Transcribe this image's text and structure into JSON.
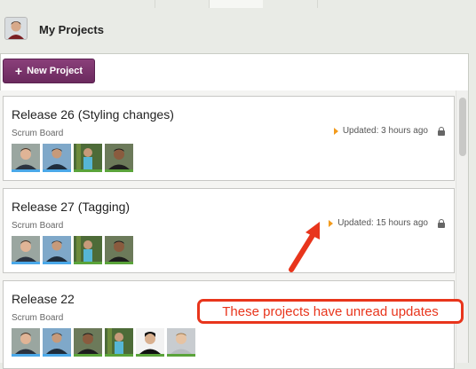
{
  "header": {
    "title": "My Projects",
    "avatar_icon": "user-avatar"
  },
  "toolbar": {
    "new_project_label": "New Project",
    "new_project_icon": "plus-icon"
  },
  "projects": [
    {
      "title": "Release 26 (Styling changes)",
      "board": "Scrum Board",
      "updated": "Updated: 3 hours ago",
      "unread": true,
      "private": true,
      "members": [
        {
          "underline": "#4aa8e8"
        },
        {
          "underline": "#4aa8e8"
        },
        {
          "underline": "#5aa33a"
        },
        {
          "underline": "#5aa33a"
        }
      ]
    },
    {
      "title": "Release 27 (Tagging)",
      "board": "Scrum Board",
      "updated": "Updated: 15 hours ago",
      "unread": true,
      "private": true,
      "members": [
        {
          "underline": "#4aa8e8"
        },
        {
          "underline": "#4aa8e8"
        },
        {
          "underline": "#5aa33a"
        },
        {
          "underline": "#5aa33a"
        }
      ]
    },
    {
      "title": "Release 22",
      "board": "Scrum Board",
      "updated": "",
      "unread": false,
      "private": false,
      "members": [
        {
          "underline": "#4aa8e8"
        },
        {
          "underline": "#4aa8e8"
        },
        {
          "underline": "#5aa33a"
        },
        {
          "underline": "#5aa33a"
        },
        {
          "underline": "#5aa33a"
        },
        {
          "underline": "#5aa33a"
        }
      ]
    }
  ],
  "annotation": {
    "text": "These projects have unread updates",
    "color": "#e8351c"
  },
  "colors": {
    "accent": "#7a3470",
    "unread_flag": "#f29b1d"
  }
}
